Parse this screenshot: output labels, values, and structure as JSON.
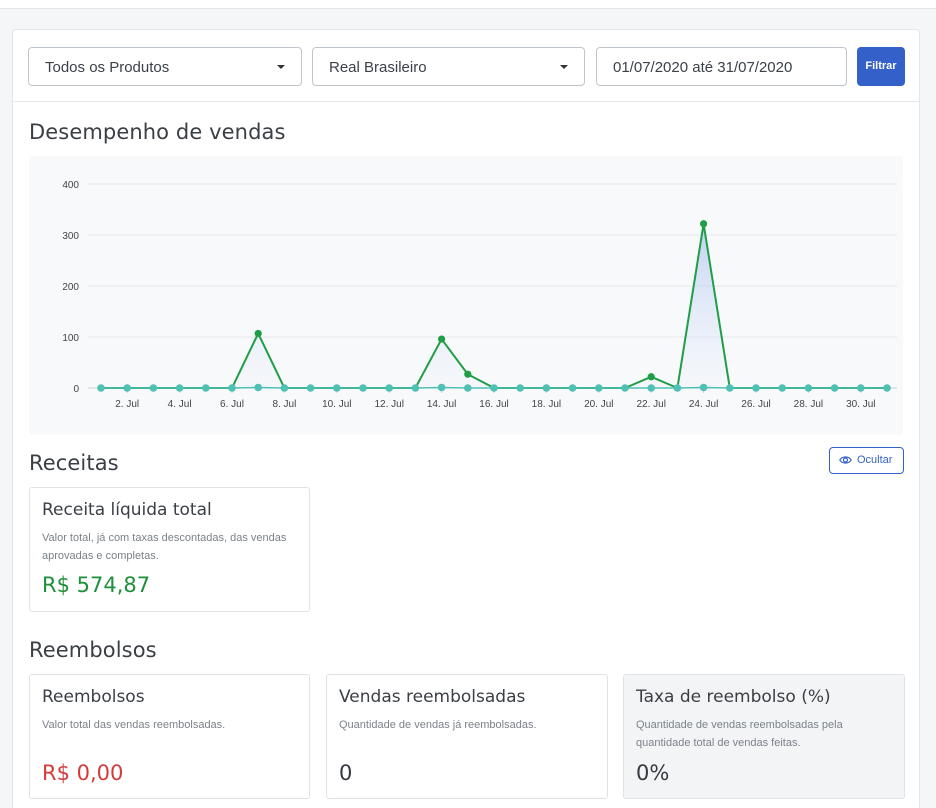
{
  "filters": {
    "product": "Todos os Produtos",
    "currency": "Real Brasileiro",
    "date_range": "01/07/2020 até 31/07/2020",
    "filter_button": "Filtrar"
  },
  "sales_section": {
    "title": "Desempenho de vendas"
  },
  "chart_data": {
    "type": "line",
    "x": [
      1,
      2,
      3,
      4,
      5,
      6,
      7,
      8,
      9,
      10,
      11,
      12,
      13,
      14,
      15,
      16,
      17,
      18,
      19,
      20,
      21,
      22,
      23,
      24,
      25,
      26,
      27,
      28,
      29,
      30,
      31
    ],
    "tick_labels": [
      "2. Jul",
      "4. Jul",
      "6. Jul",
      "8. Jul",
      "10. Jul",
      "12. Jul",
      "14. Jul",
      "16. Jul",
      "18. Jul",
      "20. Jul",
      "22. Jul",
      "24. Jul",
      "26. Jul",
      "28. Jul",
      "30. Jul"
    ],
    "tick_days": [
      2,
      4,
      6,
      8,
      10,
      12,
      14,
      16,
      18,
      20,
      22,
      24,
      26,
      28,
      30
    ],
    "y_ticks": [
      "400",
      "300",
      "200",
      "100",
      "0"
    ],
    "ylim": [
      0,
      400
    ],
    "grid": true,
    "series": [
      {
        "values": [
          0,
          0,
          0,
          0,
          0,
          0,
          107,
          0,
          0,
          0,
          0,
          0,
          0,
          96,
          27,
          0,
          0,
          0,
          0,
          0,
          0,
          22,
          0,
          322,
          0,
          0,
          0,
          0,
          0,
          0,
          0,
          0
        ],
        "color": "#1e9e45"
      },
      {
        "values": [
          0,
          0,
          0,
          0,
          0,
          0,
          1,
          0,
          0,
          0,
          0,
          0,
          0,
          1,
          0,
          0,
          0,
          0,
          0,
          0,
          0,
          0,
          0,
          1,
          0,
          0,
          0,
          0,
          0,
          0,
          0,
          0
        ],
        "color": "#4fc0b3"
      }
    ]
  },
  "revenue_section": {
    "title": "Receitas",
    "hide_button": "Ocultar",
    "net_total": {
      "title": "Receita líquida total",
      "description": "Valor total, já com taxas descontadas, das vendas aprovadas e completas.",
      "value": "R$ 574,87"
    }
  },
  "refunds_section": {
    "title": "Reembolsos",
    "cards": [
      {
        "title": "Reembolsos",
        "description": "Valor total das vendas reembolsadas.",
        "value": "R$ 0,00"
      },
      {
        "title": "Vendas reembolsadas",
        "description": "Quantidade de vendas já reembolsadas.",
        "value": "0"
      },
      {
        "title": "Taxa de reembolso (%)",
        "description": "Quantidade de vendas reembolsadas pela quantidade total de vendas feitas.",
        "value": "0%"
      }
    ]
  }
}
